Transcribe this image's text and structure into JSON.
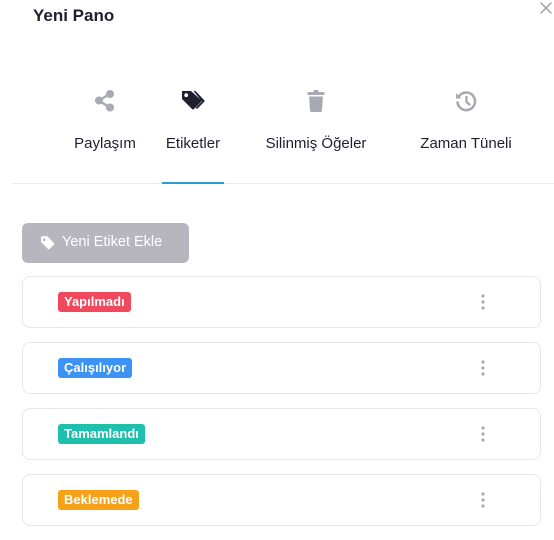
{
  "modal": {
    "title": "Yeni Pano"
  },
  "tabs": [
    {
      "label": "Paylaşım",
      "icon": "share-icon",
      "active": false
    },
    {
      "label": "Etiketler",
      "icon": "tags-icon",
      "active": true
    },
    {
      "label": "Silinmiş Öğeler",
      "icon": "trash-icon",
      "active": false
    },
    {
      "label": "Zaman Tüneli",
      "icon": "history-icon",
      "active": false
    }
  ],
  "actions": {
    "add_tag_label": "Yeni Etiket Ekle",
    "add_tag_icon": "tag-icon"
  },
  "tags": [
    {
      "label": "Yapılmadı",
      "color": "#f0485d"
    },
    {
      "label": "Çalışılıyor",
      "color": "#3d93f5"
    },
    {
      "label": "Tamamlandı",
      "color": "#1fbfae"
    },
    {
      "label": "Beklemede",
      "color": "#f6a117"
    }
  ],
  "colors": {
    "accent": "#2f9bd6",
    "icon_muted": "#a9a9b3",
    "icon_active": "#1f1f2e",
    "button_bg": "#b7b6be"
  }
}
